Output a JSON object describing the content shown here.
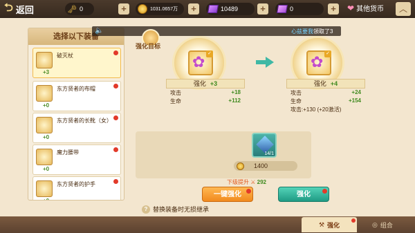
{
  "topbar": {
    "back_label": "返回",
    "resources": [
      {
        "icon": "key-icon",
        "value": "0"
      },
      {
        "icon": "gold-coin-icon",
        "value": "1031.0657万"
      },
      {
        "icon": "purple-gem-icon",
        "value": "10489"
      },
      {
        "icon": "violet-crystal-icon",
        "value": "0"
      }
    ],
    "other_currency_label": "其他货币"
  },
  "announcement": {
    "highlight": "心兹要我",
    "text": "领取了3"
  },
  "left_panel": {
    "title": "选择以下装备",
    "items": [
      {
        "name": "破灭杖",
        "level": "+3",
        "selected": true
      },
      {
        "name": "东方贤者的布帽",
        "level": "+0",
        "selected": false
      },
      {
        "name": "东方贤者的长靴（女）",
        "level": "+0",
        "selected": false
      },
      {
        "name": "魔力腰带",
        "level": "+0",
        "selected": false
      },
      {
        "name": "东方贤者的护手",
        "level": "+0",
        "selected": false
      }
    ]
  },
  "forge": {
    "target_label": "强化目标",
    "current": {
      "head_label": "强化",
      "head_value": "+3",
      "stats": [
        {
          "name": "攻击",
          "value": "+18"
        },
        {
          "name": "生命",
          "value": "+112"
        }
      ]
    },
    "next": {
      "head_label": "强化",
      "head_value": "+4",
      "stats": [
        {
          "name": "攻击",
          "value": "+24"
        },
        {
          "name": "生命",
          "value": "+154"
        }
      ],
      "extra": "攻击:+130 (+20激活)"
    }
  },
  "material": {
    "count": "14/1",
    "cost": "1400"
  },
  "next_level": {
    "label": "下级提升",
    "value": "292"
  },
  "buttons": {
    "one_key": "一键强化",
    "enhance": "强化"
  },
  "hint": "替换装备时无损继承",
  "bottom_tabs": {
    "enhance": "强化",
    "combine": "组合"
  },
  "colors": {
    "accent_orange": "#f18a1e",
    "accent_green": "#1f9b84",
    "bonus_green": "#3f8a1f"
  }
}
